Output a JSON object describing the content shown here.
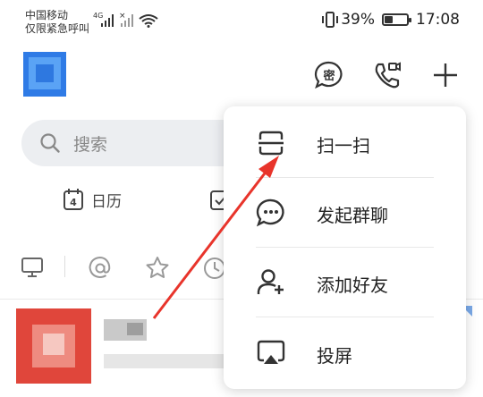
{
  "status_bar": {
    "carrier_line1": "中国移动",
    "carrier_line2": "仅限紧急呼叫",
    "network_label": "4G",
    "battery_percent": "39%",
    "time": "17:08",
    "battery_level": 0.39
  },
  "header": {
    "icons": [
      "privacy-chat-icon",
      "call-icon",
      "add-icon"
    ],
    "privacy_icon_char": "密"
  },
  "search": {
    "placeholder": "搜索"
  },
  "shortcuts": [
    {
      "label": "日历",
      "icon": "calendar-icon",
      "calendar_day": "4"
    },
    {
      "label": "",
      "icon": "todo-icon"
    }
  ],
  "filter_tabs": [
    "desktop-icon",
    "mention-icon",
    "star-icon",
    "clock-icon"
  ],
  "menu": {
    "items": [
      {
        "label": "扫一扫",
        "icon": "scan-icon"
      },
      {
        "label": "发起群聊",
        "icon": "group-chat-icon"
      },
      {
        "label": "添加好友",
        "icon": "add-friend-icon"
      },
      {
        "label": "投屏",
        "icon": "screen-cast-icon"
      }
    ]
  },
  "colors": {
    "accent_annotation": "#e8342b",
    "search_bg": "#eceef1",
    "icon_stroke": "#333333"
  }
}
